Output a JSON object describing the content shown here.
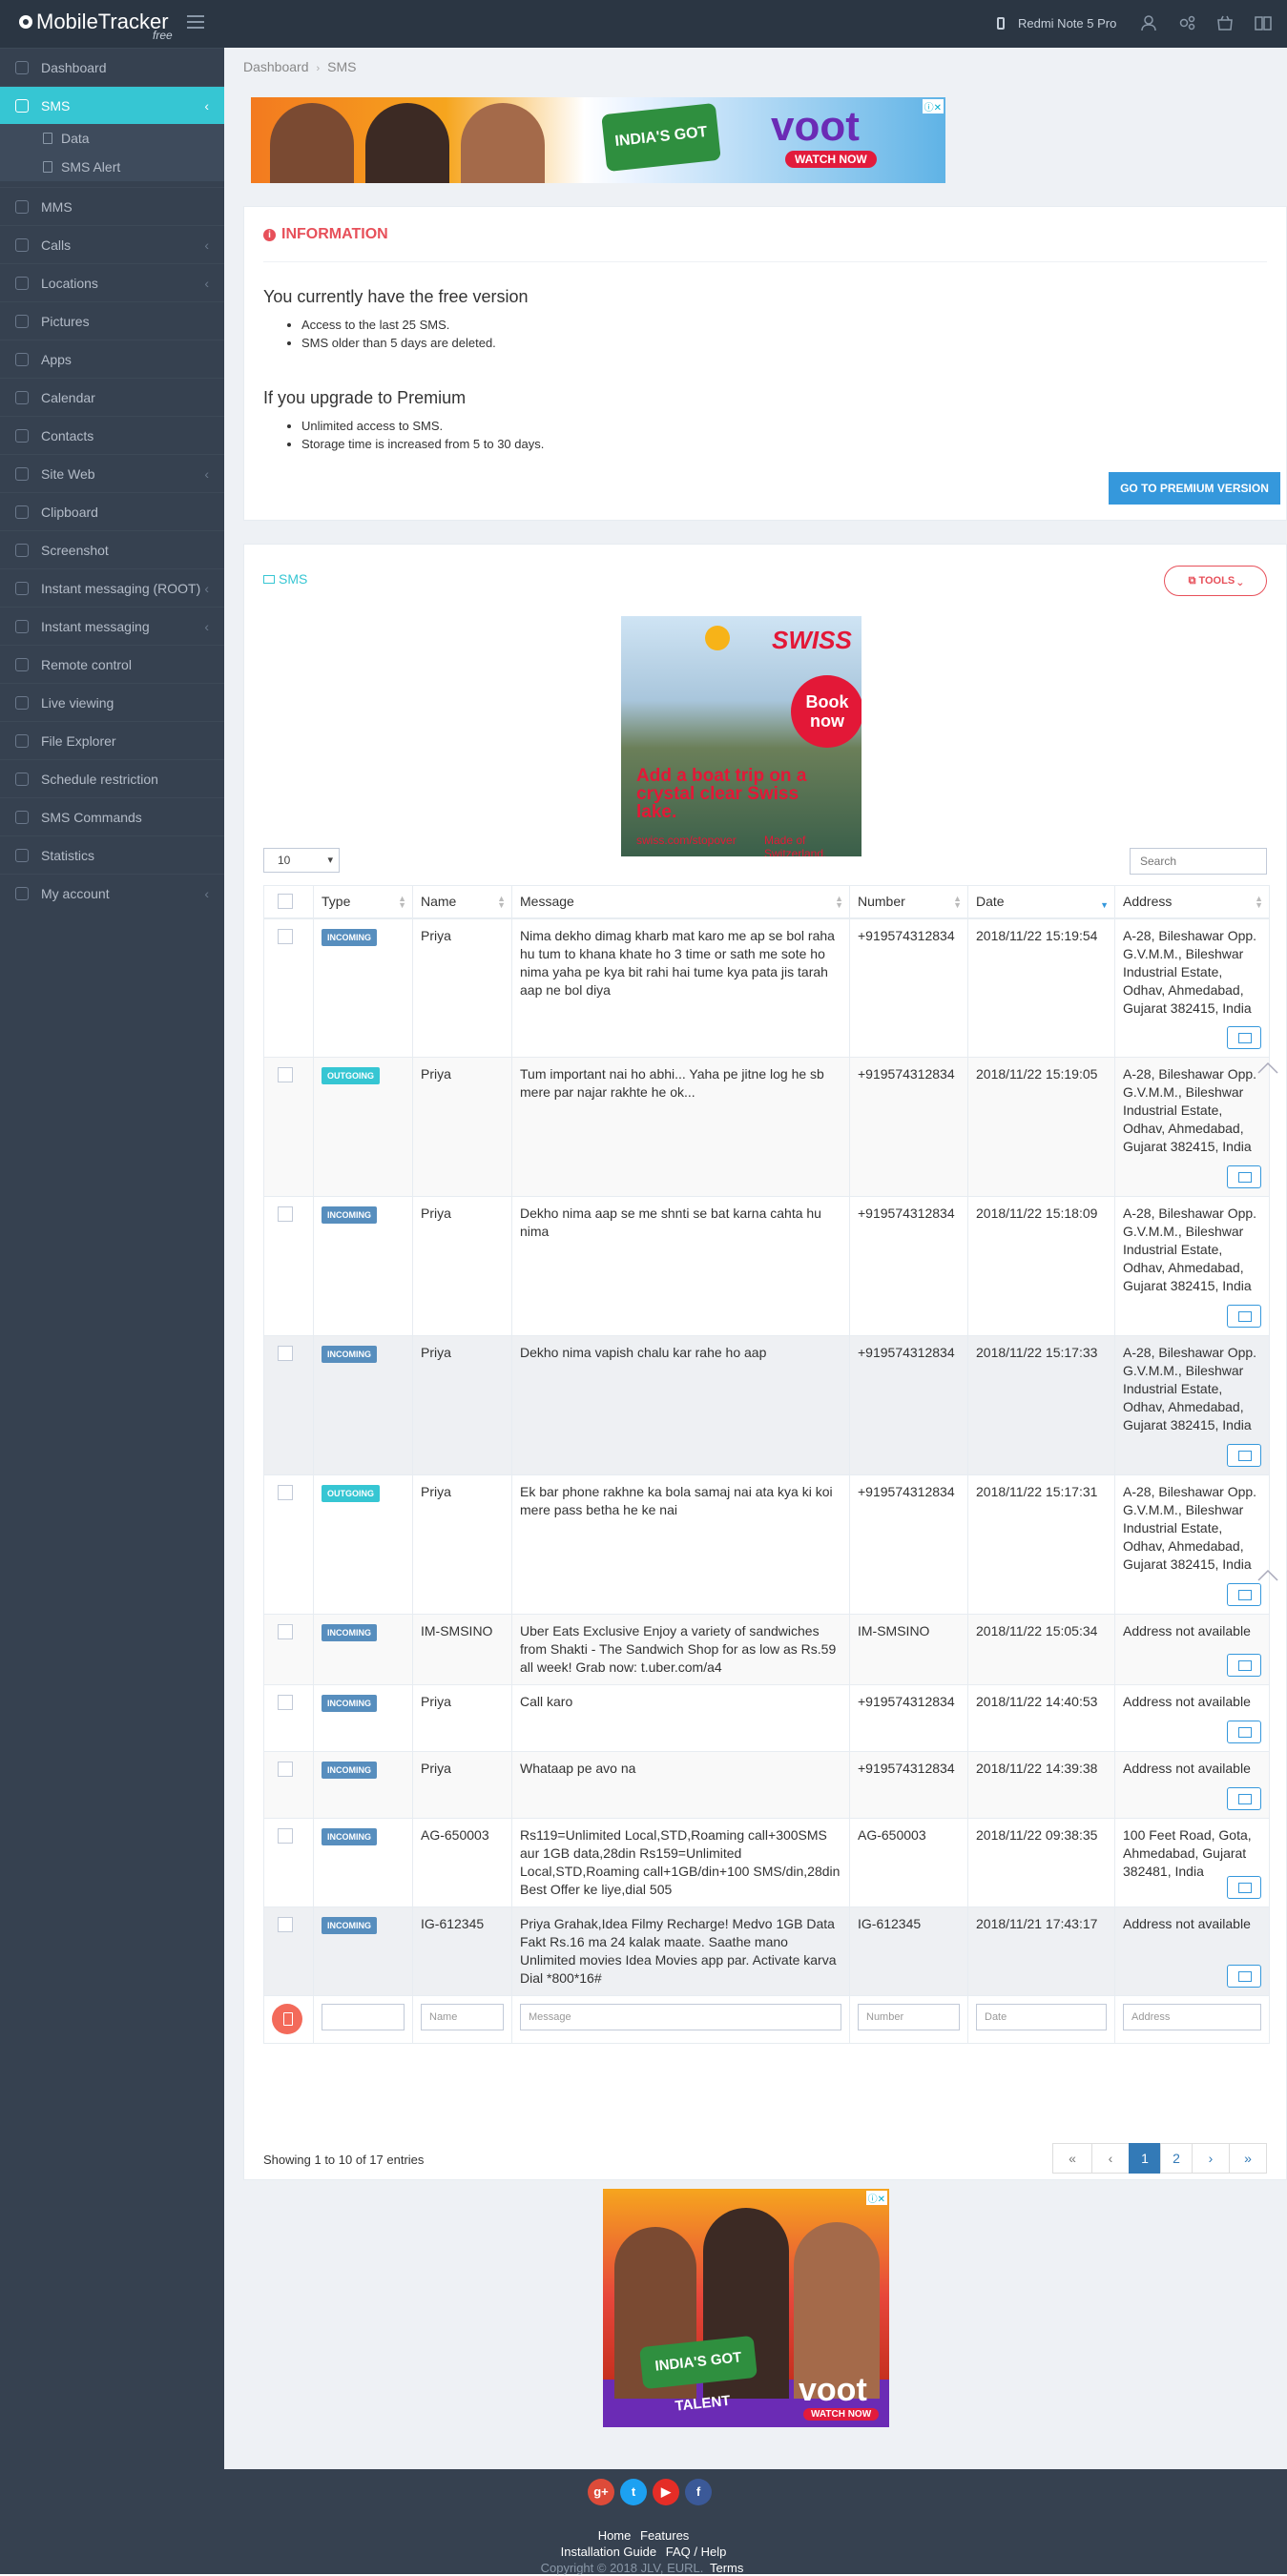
{
  "app": {
    "logo": "MobileTracker",
    "logo_sub": "free",
    "device": "Redmi Note 5 Pro"
  },
  "sidebar": {
    "items": [
      {
        "label": "Dashboard",
        "chevron": false
      },
      {
        "label": "SMS",
        "chevron": true,
        "active": true
      },
      {
        "label": "MMS",
        "chevron": false
      },
      {
        "label": "Calls",
        "chevron": true
      },
      {
        "label": "Locations",
        "chevron": true
      },
      {
        "label": "Pictures",
        "chevron": false
      },
      {
        "label": "Apps",
        "chevron": false
      },
      {
        "label": "Calendar",
        "chevron": false
      },
      {
        "label": "Contacts",
        "chevron": false
      },
      {
        "label": "Site Web",
        "chevron": true
      },
      {
        "label": "Clipboard",
        "chevron": false
      },
      {
        "label": "Screenshot",
        "chevron": false
      },
      {
        "label": "Instant messaging (ROOT)",
        "chevron": true
      },
      {
        "label": "Instant messaging",
        "chevron": true
      },
      {
        "label": "Remote control",
        "chevron": false
      },
      {
        "label": "Live viewing",
        "chevron": false
      },
      {
        "label": "File Explorer",
        "chevron": false
      },
      {
        "label": "Schedule restriction",
        "chevron": false
      },
      {
        "label": "SMS Commands",
        "chevron": false
      },
      {
        "label": "Statistics",
        "chevron": false
      },
      {
        "label": "My account",
        "chevron": true
      }
    ],
    "sms_sub": [
      {
        "label": "Data"
      },
      {
        "label": "SMS Alert"
      }
    ]
  },
  "breadcrumb": {
    "home": "Dashboard",
    "current": "SMS"
  },
  "ads": {
    "top": {
      "title": "INDIA'S GOT TALENT",
      "brand": "voot",
      "cta": "WATCH NOW"
    },
    "swiss": {
      "brand": "SWISS",
      "cta": "Book now",
      "copy": "Add a boat trip on a crystal clear Swiss lake.",
      "url": "swiss.com/stopover",
      "tagline": "Made of Switzerland."
    },
    "bottom": {
      "title": "INDIA'S GOT TALENT",
      "brand": "voot",
      "cta": "WATCH NOW"
    }
  },
  "info": {
    "title": "INFORMATION",
    "free_heading": "You currently have the free version",
    "free_points": [
      "Access to the last 25 SMS.",
      "SMS older than 5 days are deleted."
    ],
    "premium_heading": "If you upgrade to Premium",
    "premium_points": [
      "Unlimited access to SMS.",
      "Storage time is increased from 5 to 30 days."
    ],
    "premium_button": "GO TO PREMIUM VERSION"
  },
  "sms": {
    "title": "SMS",
    "tools_button": "TOOLS",
    "page_length": "10",
    "search_placeholder": "Search",
    "columns": [
      "Type",
      "Name",
      "Message",
      "Number",
      "Date",
      "Address"
    ],
    "rows": [
      {
        "type": "INCOMING",
        "name": "Priya",
        "message": "Nima dekho dimag kharb mat karo me ap se bol raha hu tum to khana khate ho 3 time or sath me sote ho nima yaha pe kya bit rahi hai tume kya pata jis tarah aap ne bol diya",
        "number": "+919574312834",
        "date": "2018/11/22 15:19:54",
        "address": "A-28, Bileshawar Opp. G.V.M.M., Bileshwar Industrial Estate, Odhav, Ahmedabad, Gujarat 382415, India"
      },
      {
        "type": "OUTGOING",
        "name": "Priya",
        "message": "Tum important nai ho abhi... Yaha pe jitne log he sb mere par najar rakhte he ok...",
        "number": "+919574312834",
        "date": "2018/11/22 15:19:05",
        "address": "A-28, Bileshawar Opp. G.V.M.M., Bileshwar Industrial Estate, Odhav, Ahmedabad, Gujarat 382415, India"
      },
      {
        "type": "INCOMING",
        "name": "Priya",
        "message": "Dekho nima aap se me shnti se bat karna cahta hu nima",
        "number": "+919574312834",
        "date": "2018/11/22 15:18:09",
        "address": "A-28, Bileshawar Opp. G.V.M.M., Bileshwar Industrial Estate, Odhav, Ahmedabad, Gujarat 382415, India"
      },
      {
        "type": "INCOMING",
        "name": "Priya",
        "message": "Dekho nima vapish chalu kar rahe ho aap",
        "number": "+919574312834",
        "date": "2018/11/22 15:17:33",
        "address": "A-28, Bileshawar Opp. G.V.M.M., Bileshwar Industrial Estate, Odhav, Ahmedabad, Gujarat 382415, India"
      },
      {
        "type": "OUTGOING",
        "name": "Priya",
        "message": "Ek bar phone rakhne ka bola samaj nai ata kya ki koi mere pass betha he ke nai",
        "number": "+919574312834",
        "date": "2018/11/22 15:17:31",
        "address": "A-28, Bileshawar Opp. G.V.M.M., Bileshwar Industrial Estate, Odhav, Ahmedabad, Gujarat 382415, India"
      },
      {
        "type": "INCOMING",
        "name": "IM-SMSINO",
        "message": "Uber Eats Exclusive Enjoy a variety of sandwiches from Shakti - The Sandwich Shop for as low as Rs.59 all week! Grab now: t.uber.com/a4",
        "number": "IM-SMSINO",
        "date": "2018/11/22 15:05:34",
        "address": "Address not available"
      },
      {
        "type": "INCOMING",
        "name": "Priya",
        "message": "Call karo",
        "number": "+919574312834",
        "date": "2018/11/22 14:40:53",
        "address": "Address not available"
      },
      {
        "type": "INCOMING",
        "name": "Priya",
        "message": "Whataap pe avo na",
        "number": "+919574312834",
        "date": "2018/11/22 14:39:38",
        "address": "Address not available"
      },
      {
        "type": "INCOMING",
        "name": "AG-650003",
        "message": "Rs119=Unlimited Local,STD,Roaming call+300SMS aur 1GB data,28din Rs159=Unlimited Local,STD,Roaming call+1GB/din+100 SMS/din,28din Best Offer ke liye,dial 505",
        "number": "AG-650003",
        "date": "2018/11/22 09:38:35",
        "address": "100 Feet Road, Gota, Ahmedabad, Gujarat 382481, India"
      },
      {
        "type": "INCOMING",
        "name": "IG-612345",
        "message": "Priya Grahak,Idea Filmy Recharge! Medvo 1GB Data Fakt Rs.16 ma 24 kalak maate. Saathe mano Unlimited movies Idea Movies app par. Activate karva Dial *800*16#",
        "number": "IG-612345",
        "date": "2018/11/21 17:43:17",
        "address": "Address not available"
      }
    ],
    "filters": {
      "name": "Name",
      "message": "Message",
      "number": "Number",
      "date": "Date",
      "address": "Address"
    },
    "showing": "Showing 1 to 10 of 17 entries",
    "pager": [
      "«",
      "‹",
      "1",
      "2",
      "›",
      "»"
    ]
  },
  "footer": {
    "socials": [
      "g+",
      "t",
      "▶",
      "f"
    ],
    "links": [
      "Home",
      "Features",
      "Installation Guide",
      "FAQ / Help"
    ],
    "copyright": "Copyright © 2018 JLV, EURL.",
    "terms": "Terms"
  },
  "colors": {
    "sidebar": "#364150",
    "topbar": "#2b3643",
    "accent": "#36c6d3",
    "danger": "#e7505a",
    "primary": "#3598dc",
    "incoming": "#578ebe",
    "outgoing": "#36c6d3"
  }
}
